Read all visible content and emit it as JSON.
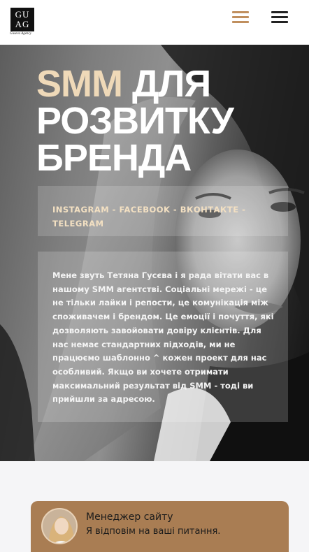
{
  "header": {
    "logo_line1": "GU",
    "logo_line2": "AG",
    "logo_subtitle": "Guseva Agency",
    "menu_icon_gold": "hamburger-menu-icon",
    "menu_icon_dark": "hamburger-menu-icon"
  },
  "hero": {
    "title_accent": "SMM",
    "title_rest": "для розвитку бренда",
    "social_line": "INSTAGRAM - FACEBOOK - ВКОНТАКТЕ - TELEGRAM",
    "description": "Мене звуть Тетяна Гусєва і я рада вітати вас в нашому SMM агентстві. Соціальні мережі - це не тільки лайки і репости, це комунікація між споживачем і брендом. Це емоції і почуття, які дозволяють завойовати довіру клієнтів. Для нас немає стандартних підходів, ми не працюємо шаблонно ^ кожен проект для нас особливий. Якщо ви хочете отримати максимальний результат від SMM - тоді ви прийшли за адресою."
  },
  "chat": {
    "title": "Менеджер сайту",
    "subtitle": "Я відповім на ваші питання."
  },
  "colors": {
    "accent_gold": "#c08f5e",
    "title_accent": "#efd9b8",
    "chat_background": "#a97d53"
  }
}
